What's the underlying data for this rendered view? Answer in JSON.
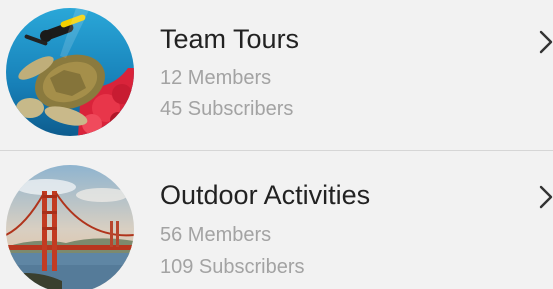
{
  "groups": [
    {
      "title": "Team Tours",
      "members": "12 Members",
      "subscribers": "45 Subscribers",
      "image": "sea-turtle-diver-photo"
    },
    {
      "title": "Outdoor Activities",
      "members": "56 Members",
      "subscribers": "109 Subscribers",
      "image": "golden-gate-bridge-photo"
    }
  ],
  "chevron_icon": "chevron-right-icon",
  "colors": {
    "background": "#f2f2f2",
    "title": "#222222",
    "subtitle": "#a3a3a3",
    "divider": "#d6d6d6"
  }
}
